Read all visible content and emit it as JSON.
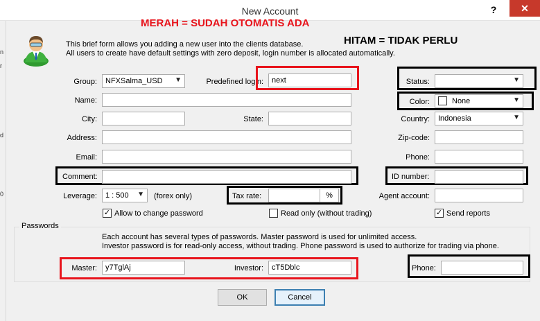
{
  "window": {
    "title": "New Account",
    "help_label": "?",
    "close_label": "✕"
  },
  "left_strip": [
    "n",
    "r",
    "d",
    "0"
  ],
  "annotations": {
    "red_note": "MERAH = SUDAH OTOMATIS ADA",
    "black_note": "HITAM = TIDAK PERLU"
  },
  "intro": {
    "line1": "This brief form allows you adding a new user into the clients database.",
    "line2": "All users to create have default settings with zero deposit, login number is allocated automatically."
  },
  "fields": {
    "group": {
      "label": "Group:",
      "value": "NFXSalma_USD"
    },
    "predefined_login": {
      "label": "Predefined login:",
      "value": "next"
    },
    "status": {
      "label": "Status:",
      "value": ""
    },
    "name": {
      "label": "Name:",
      "value": ""
    },
    "color": {
      "label": "Color:",
      "value": "None"
    },
    "city": {
      "label": "City:",
      "value": ""
    },
    "state": {
      "label": "State:",
      "value": ""
    },
    "country": {
      "label": "Country:",
      "value": "Indonesia"
    },
    "address": {
      "label": "Address:",
      "value": ""
    },
    "zip": {
      "label": "Zip-code:",
      "value": ""
    },
    "email": {
      "label": "Email:",
      "value": ""
    },
    "phone": {
      "label": "Phone:",
      "value": ""
    },
    "comment": {
      "label": "Comment:",
      "value": ""
    },
    "id_number": {
      "label": "ID number:",
      "value": ""
    },
    "leverage": {
      "label": "Leverage:",
      "value": "1 : 500",
      "suffix": "(forex only)"
    },
    "tax_rate": {
      "label": "Tax rate:",
      "value": "",
      "suffix": "%"
    },
    "agent_account": {
      "label": "Agent account:",
      "value": ""
    }
  },
  "checkboxes": {
    "allow_change_password": {
      "label": "Allow to change password",
      "checked": true
    },
    "read_only": {
      "label": "Read only (without trading)",
      "checked": false
    },
    "send_reports": {
      "label": "Send reports",
      "checked": true
    }
  },
  "passwords": {
    "group_label": "Passwords",
    "info1": "Each account has several types of passwords. Master password is used for unlimited access.",
    "info2": "Investor password is for read-only access, without trading. Phone password is used to authorize for trading via phone.",
    "master": {
      "label": "Master:",
      "value": "y7TglAj"
    },
    "investor": {
      "label": "Investor:",
      "value": "cT5Dblc"
    },
    "phone": {
      "label": "Phone:",
      "value": ""
    }
  },
  "buttons": {
    "ok": "OK",
    "cancel": "Cancel"
  },
  "colors": {
    "annotation_red": "#e8141c",
    "annotation_black": "#000000",
    "close_red": "#c7392b"
  }
}
